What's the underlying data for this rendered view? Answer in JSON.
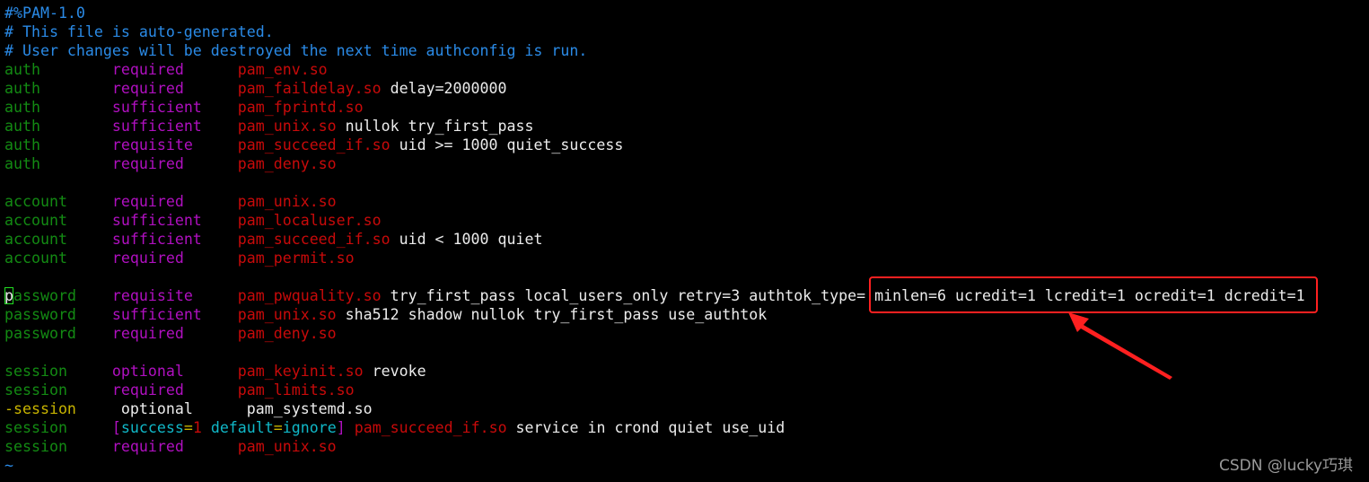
{
  "colors": {
    "comment": "#2a8ae6",
    "type": "#138a13",
    "control": "#b010c0",
    "module": "#c80a0a",
    "arg": "#ececec",
    "yellow": "#c8b400",
    "cyan": "#10b8c8",
    "annotation": "#ff2020",
    "cursor": "#22dd22"
  },
  "editor": {
    "cursor_line": 15,
    "lines": [
      [
        [
          "#%PAM-1.0",
          "comment"
        ]
      ],
      [
        [
          "# This file is auto-generated.",
          "comment"
        ]
      ],
      [
        [
          "# User changes will be destroyed the next time authconfig is run.",
          "comment"
        ]
      ],
      [
        [
          "auth        ",
          "type"
        ],
        [
          "required      ",
          "control"
        ],
        [
          "pam_env.so",
          "module"
        ]
      ],
      [
        [
          "auth        ",
          "type"
        ],
        [
          "required      ",
          "control"
        ],
        [
          "pam_faildelay.so",
          "module"
        ],
        [
          " delay=2000000",
          "arg"
        ]
      ],
      [
        [
          "auth        ",
          "type"
        ],
        [
          "sufficient    ",
          "control"
        ],
        [
          "pam_fprintd.so",
          "module"
        ]
      ],
      [
        [
          "auth        ",
          "type"
        ],
        [
          "sufficient    ",
          "control"
        ],
        [
          "pam_unix.so",
          "module"
        ],
        [
          " nullok try_first_pass",
          "arg"
        ]
      ],
      [
        [
          "auth        ",
          "type"
        ],
        [
          "requisite     ",
          "control"
        ],
        [
          "pam_succeed_if.so",
          "module"
        ],
        [
          " uid >= 1000 quiet_success",
          "arg"
        ]
      ],
      [
        [
          "auth        ",
          "type"
        ],
        [
          "required      ",
          "control"
        ],
        [
          "pam_deny.so",
          "module"
        ]
      ],
      [],
      [
        [
          "account     ",
          "type"
        ],
        [
          "required      ",
          "control"
        ],
        [
          "pam_unix.so",
          "module"
        ]
      ],
      [
        [
          "account     ",
          "type"
        ],
        [
          "sufficient    ",
          "control"
        ],
        [
          "pam_localuser.so",
          "module"
        ]
      ],
      [
        [
          "account     ",
          "type"
        ],
        [
          "sufficient    ",
          "control"
        ],
        [
          "pam_succeed_if.so",
          "module"
        ],
        [
          " uid < 1000 quiet",
          "arg"
        ]
      ],
      [
        [
          "account     ",
          "type"
        ],
        [
          "required      ",
          "control"
        ],
        [
          "pam_permit.so",
          "module"
        ]
      ],
      [],
      [
        [
          "p",
          "arg"
        ],
        [
          "assword    ",
          "type"
        ],
        [
          "requisite     ",
          "control"
        ],
        [
          "pam_pwquality.so",
          "module"
        ],
        [
          " try_first_pass local_users_only retry=3 authtok_type= minlen=6 ucredit=1 lcredit=1 ocredit=1 dcredit=1",
          "arg"
        ]
      ],
      [
        [
          "password    ",
          "type"
        ],
        [
          "sufficient    ",
          "control"
        ],
        [
          "pam_unix.so",
          "module"
        ],
        [
          " sha512 shadow nullok try_first_pass use_authtok",
          "arg"
        ]
      ],
      [
        [
          "password    ",
          "type"
        ],
        [
          "required      ",
          "control"
        ],
        [
          "pam_deny.so",
          "module"
        ]
      ],
      [],
      [
        [
          "session     ",
          "type"
        ],
        [
          "optional      ",
          "control"
        ],
        [
          "pam_keyinit.so",
          "module"
        ],
        [
          " revoke",
          "arg"
        ]
      ],
      [
        [
          "session     ",
          "type"
        ],
        [
          "required      ",
          "control"
        ],
        [
          "pam_limits.so",
          "module"
        ]
      ],
      [
        [
          "-session",
          "yellow"
        ],
        [
          "     optional      pam_systemd.so",
          "arg"
        ]
      ],
      [
        [
          "session     ",
          "type"
        ],
        [
          "[",
          "control"
        ],
        [
          "success",
          "cyan"
        ],
        [
          "=",
          "yellow"
        ],
        [
          "1",
          "module"
        ],
        [
          " ",
          "arg"
        ],
        [
          "default",
          "cyan"
        ],
        [
          "=",
          "yellow"
        ],
        [
          "ignore",
          "cyan"
        ],
        [
          "]",
          "control"
        ],
        [
          " ",
          "arg"
        ],
        [
          "pam_succeed_if.so",
          "module"
        ],
        [
          " service in crond quiet use_uid",
          "arg"
        ]
      ],
      [
        [
          "session     ",
          "type"
        ],
        [
          "required      ",
          "control"
        ],
        [
          "pam_unix.so",
          "module"
        ]
      ],
      [
        [
          "~",
          "tilde"
        ]
      ]
    ]
  },
  "watermark": "CSDN @lucky巧琪"
}
